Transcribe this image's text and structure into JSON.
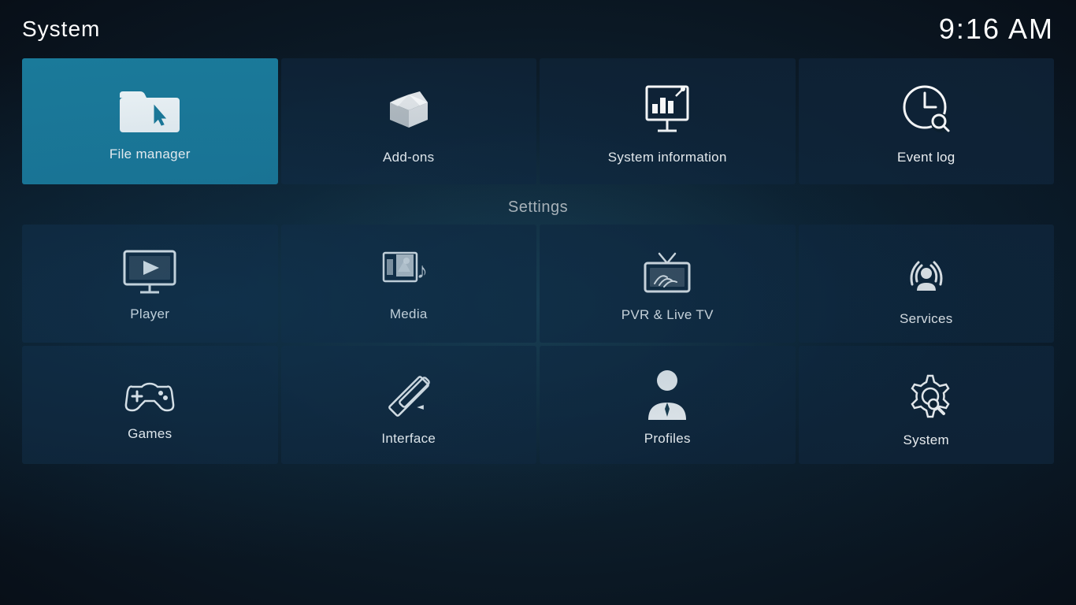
{
  "header": {
    "title": "System",
    "time": "9:16 AM"
  },
  "top_tiles": [
    {
      "id": "file-manager",
      "label": "File manager",
      "active": true
    },
    {
      "id": "add-ons",
      "label": "Add-ons",
      "active": false
    },
    {
      "id": "system-information",
      "label": "System information",
      "active": false
    },
    {
      "id": "event-log",
      "label": "Event log",
      "active": false
    }
  ],
  "settings_section": {
    "title": "Settings"
  },
  "settings_row1": [
    {
      "id": "player",
      "label": "Player"
    },
    {
      "id": "media",
      "label": "Media"
    },
    {
      "id": "pvr-live-tv",
      "label": "PVR & Live TV"
    },
    {
      "id": "services",
      "label": "Services"
    }
  ],
  "settings_row2": [
    {
      "id": "games",
      "label": "Games"
    },
    {
      "id": "interface",
      "label": "Interface"
    },
    {
      "id": "profiles",
      "label": "Profiles"
    },
    {
      "id": "system",
      "label": "System"
    }
  ]
}
